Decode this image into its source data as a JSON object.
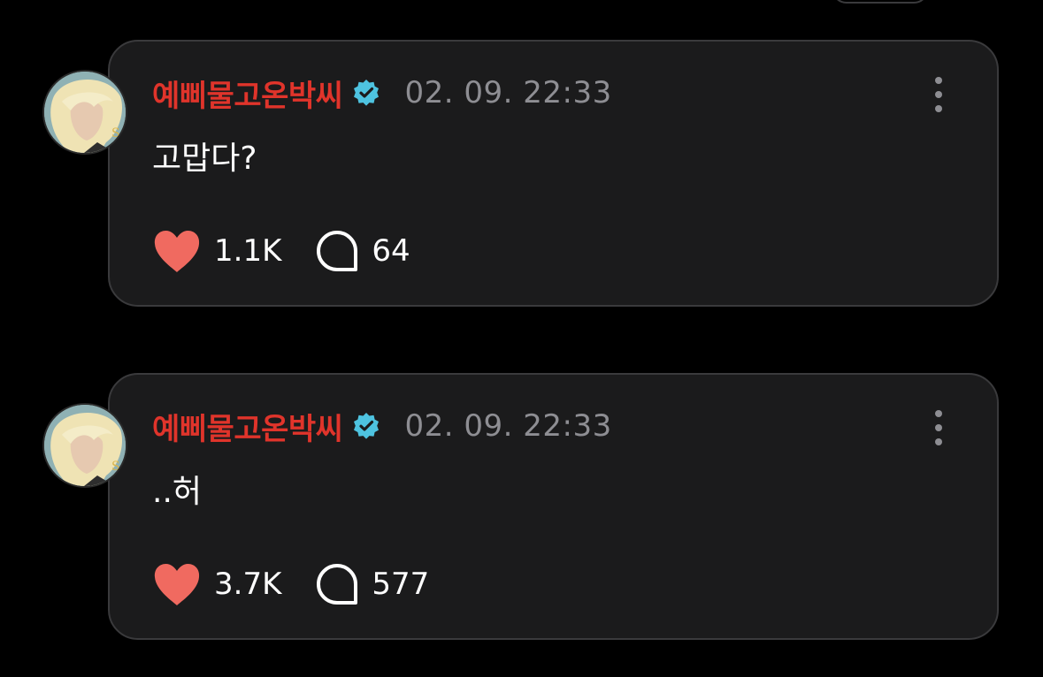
{
  "posts": [
    {
      "username": "예삐물고온박씨",
      "timestamp": "02. 09. 22:33",
      "text": "고맙다?",
      "likes": "1.1K",
      "comments": "64"
    },
    {
      "username": "예삐물고온박씨",
      "timestamp": "02. 09. 22:33",
      "text": "..허",
      "likes": "3.7K",
      "comments": "577"
    }
  ],
  "icons": {
    "verified": "verified-badge-icon",
    "like": "heart-icon",
    "comment": "comment-bubble-icon",
    "more": "more-vertical-icon"
  },
  "colors": {
    "username": "#e0342b",
    "heart": "#f06a60",
    "verified": "#4ec3e0",
    "card_background": "#1b1b1c",
    "timestamp": "#8e8e93"
  }
}
